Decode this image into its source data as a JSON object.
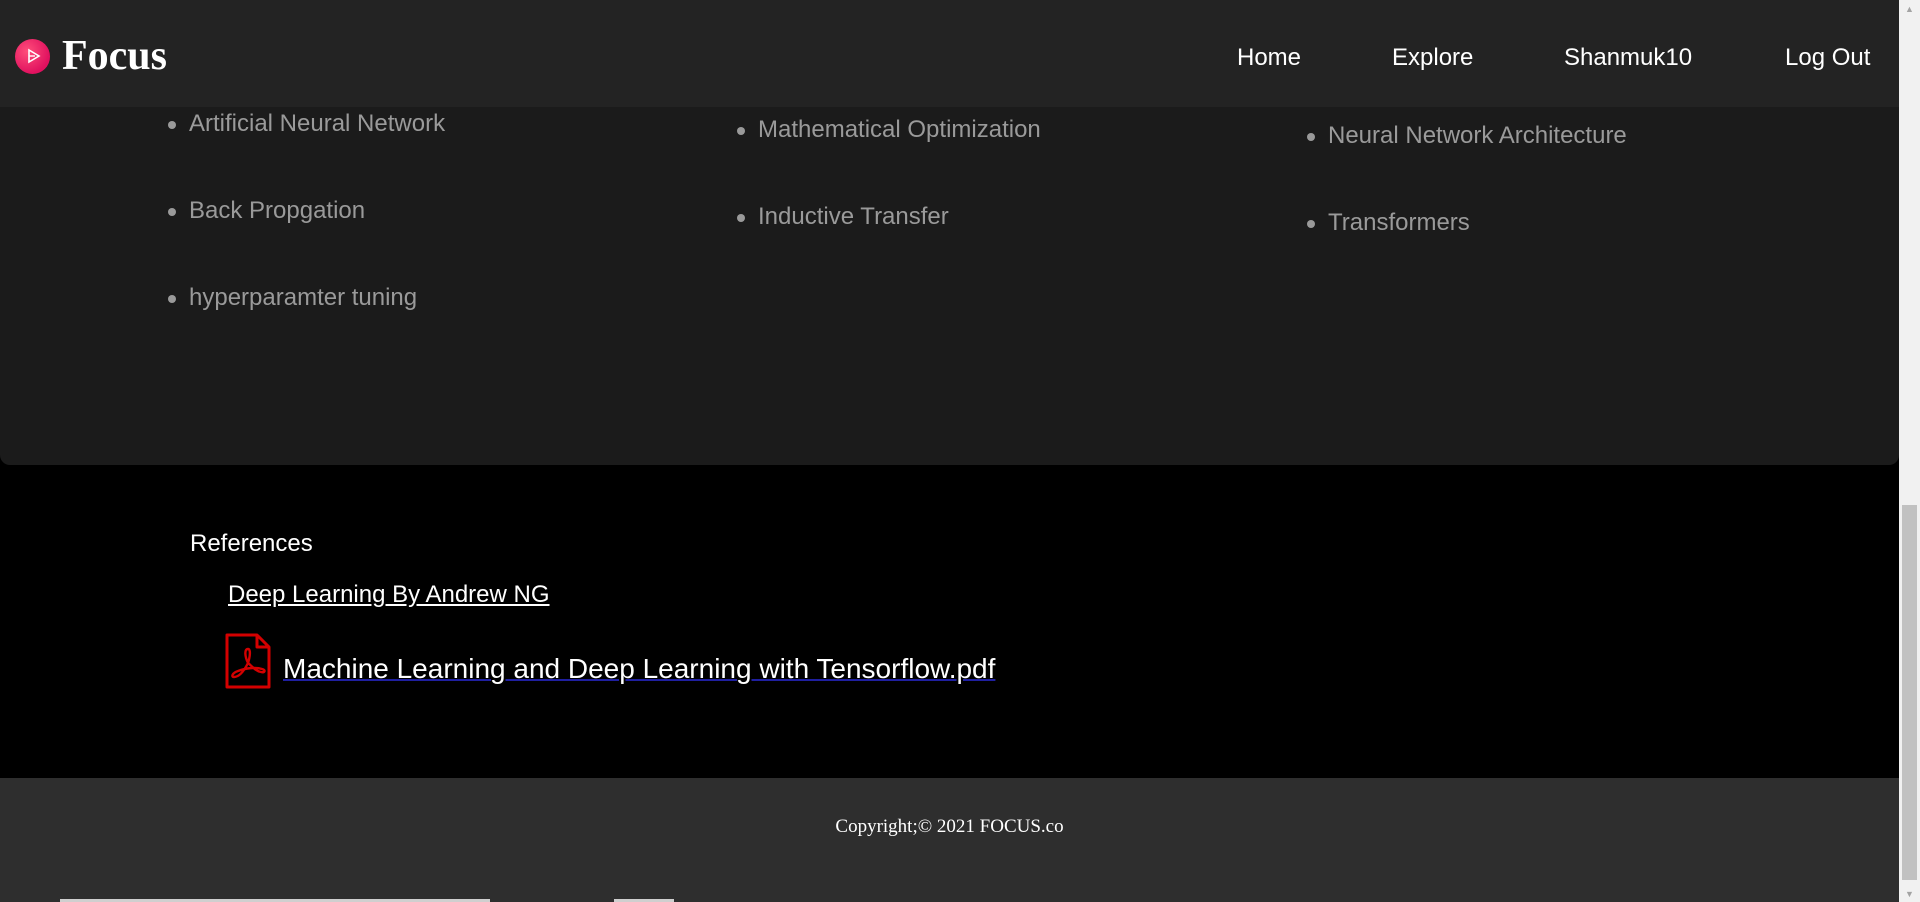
{
  "header": {
    "brand": "Focus",
    "nav": {
      "home": "Home",
      "explore": "Explore",
      "user": "Shanmuk10",
      "logout": "Log Out"
    }
  },
  "topics": {
    "column1": [
      "Artificial Neural Network",
      "Back Propgation",
      "hyperparamter tuning"
    ],
    "column2": [
      "Mathematical Optimization",
      "Inductive Transfer"
    ],
    "column3": [
      "Neural Network Architecture",
      "Transformers"
    ]
  },
  "references": {
    "heading": "References",
    "link": "Deep Learning By Andrew NG",
    "pdf": "Machine Learning and Deep Learning with Tensorflow.pdf"
  },
  "footer": {
    "copyright": "Copyright;© 2021 FOCUS.co"
  },
  "icons": {
    "brand_logo": "play-circle-icon",
    "pdf": "pdf-file-icon"
  },
  "colors": {
    "accent": "#e0115f",
    "pdf_red": "#d40000",
    "header_bg": "#232323",
    "card_bg": "#1b1b1b",
    "footer_bg": "#2e2e2e"
  }
}
